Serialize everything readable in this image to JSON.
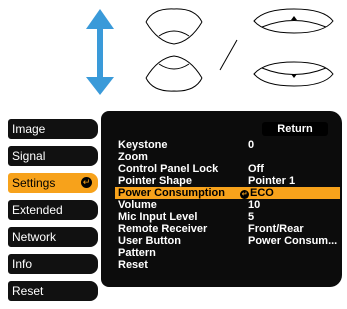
{
  "sidebar": {
    "items": [
      {
        "label": "Image"
      },
      {
        "label": "Signal"
      },
      {
        "label": "Settings",
        "selected": true
      },
      {
        "label": "Extended"
      },
      {
        "label": "Network"
      },
      {
        "label": "Info"
      },
      {
        "label": "Reset"
      }
    ]
  },
  "panel": {
    "return_label": "Return",
    "rows": [
      {
        "label": "Keystone",
        "value": "0"
      },
      {
        "label": "Zoom",
        "value": ""
      },
      {
        "label": "Control Panel Lock",
        "value": "Off"
      },
      {
        "label": "Pointer Shape",
        "value": "Pointer 1"
      },
      {
        "label": "Power Consumption",
        "value": "ECO",
        "selected": true
      },
      {
        "label": "Volume",
        "value": "10"
      },
      {
        "label": "Mic Input Level",
        "value": "5"
      },
      {
        "label": "Remote Receiver",
        "value": "Front/Rear"
      },
      {
        "label": "User Button",
        "value": "Power Consum..."
      },
      {
        "label": "Pattern",
        "value": ""
      },
      {
        "label": "Reset",
        "value": ""
      }
    ]
  },
  "colors": {
    "highlight": "#f7a21b",
    "arrow": "#3a9ad9",
    "panel": "#0c0c0c"
  }
}
